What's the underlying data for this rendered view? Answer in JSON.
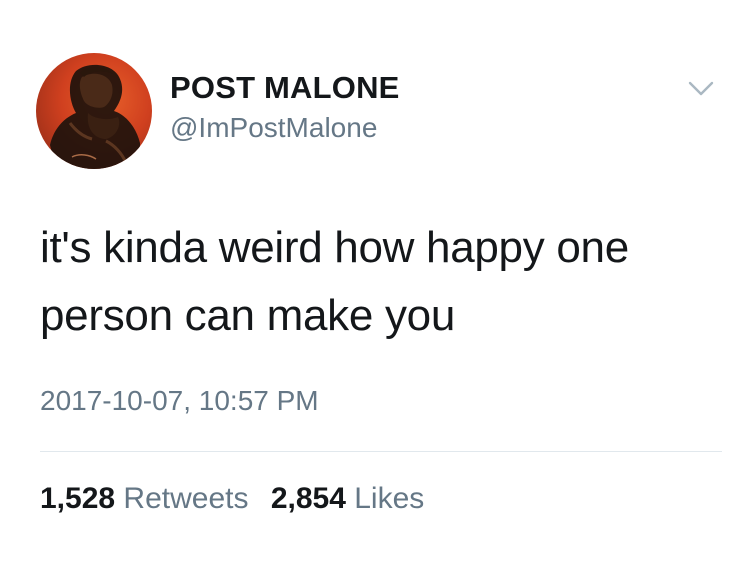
{
  "colors": {
    "text_primary": "#14171a",
    "text_secondary": "#657786",
    "divider": "#e1e8ed",
    "avatar_background": "#d0401f"
  },
  "author": {
    "display_name": "POST MALONE",
    "handle": "@ImPostMalone",
    "avatar_icon": "profile-photo"
  },
  "menu": {
    "icon": "chevron-down-icon"
  },
  "tweet": {
    "text_line_1": "it's kinda weird how happy one",
    "text_line_2": "person can make you",
    "timestamp": "2017-10-07, 10:57 PM"
  },
  "stats": {
    "retweets_count": "1,528",
    "retweets_label": "Retweets",
    "likes_count": "2,854",
    "likes_label": "Likes"
  }
}
